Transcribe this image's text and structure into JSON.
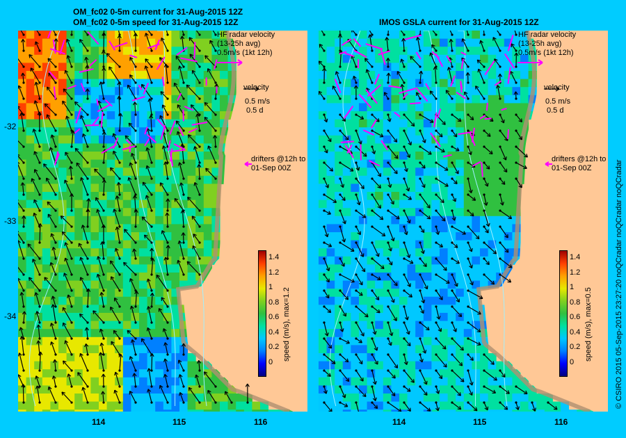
{
  "titles": {
    "left_line1": "OM_fc02 0-5m current for 31-Aug-2015 12Z",
    "left_line2": "OM_fc02 0-5m speed for 31-Aug-2015 12Z",
    "right": "IMOS GSLA current for 31-Aug-2015 12Z"
  },
  "legend": {
    "hf_line1": "HF radar velocity",
    "hf_line2": "(13-25h avg)",
    "hf_line3": "0.5m/s (1kt 12h)",
    "velocity": "velocity",
    "vel_ms": "0.5 m/s",
    "vel_d": "0.5 d",
    "drifters_line1": "drifters @12h to",
    "drifters_line2": "01-Sep 00Z"
  },
  "colorbar": {
    "ticks": [
      "1.4",
      "1.2",
      "1",
      "0.8",
      "0.6",
      "0.4",
      "0.2",
      "0"
    ],
    "left_label": "speed (m/s), max=1.2",
    "right_label": "speed (m/s), max=0.5",
    "colors": [
      "#000080",
      "#0000ff",
      "#0080ff",
      "#00c8ff",
      "#00e0a0",
      "#30c040",
      "#80d020",
      "#e8e800",
      "#ffa000",
      "#ff4000",
      "#a00000"
    ]
  },
  "axes": {
    "y_ticks": [
      "-32",
      "-33",
      "-34"
    ],
    "x_ticks": [
      "114",
      "115",
      "116"
    ]
  },
  "credit": "© CSIRO 2015   05-Sep-2015 23:27:20 noQCradar noQCradar noQCradar",
  "colors": {
    "background": "#00ccff",
    "land": "#ffc896",
    "hf_vector": "#ff00ff"
  }
}
